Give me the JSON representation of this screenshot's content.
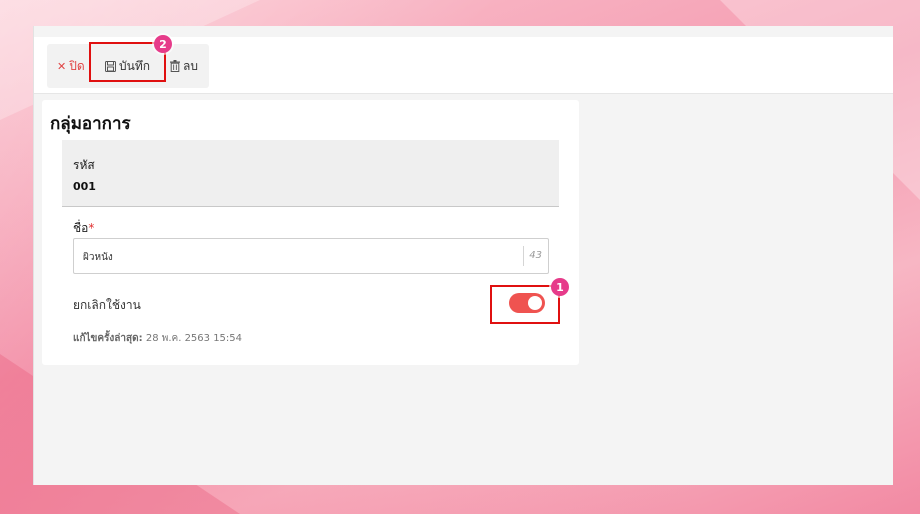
{
  "toolbar": {
    "close_label": "ปิด",
    "save_label": "บันทึก",
    "delete_label": "ลบ"
  },
  "form": {
    "title": "กลุ่มอาการ",
    "code_label": "รหัส",
    "code_value": "001",
    "name_label": "ชื่อ",
    "required_mark": "*",
    "name_value": "ผิวหนัง",
    "name_char_count": "43",
    "cancel_label": "ยกเลิกใช้งาน",
    "cancel_toggle_on": true,
    "last_edit_label": "แก้ไขครั้งล่าสุด:",
    "last_edit_value": "28 พ.ค. 2563 15:54"
  },
  "annotations": {
    "badge_1": "1",
    "badge_2": "2"
  },
  "colors": {
    "toggle_on": "#ef5350",
    "highlight": "#e01010",
    "badge": "#e63b8a",
    "close_text": "#e04545"
  }
}
